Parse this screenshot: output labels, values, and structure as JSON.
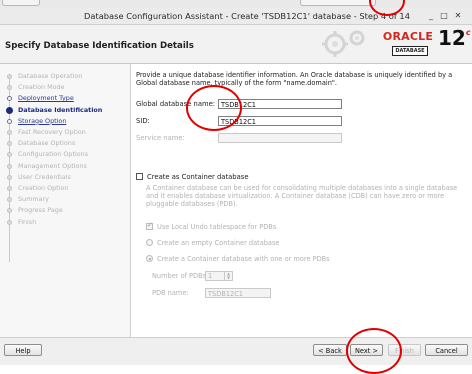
{
  "window": {
    "title": "Database Configuration Assistant - Create 'TSDB12C1' database - Step 4 of 14",
    "minimize_glyph": "_",
    "maximize_glyph": "□",
    "close_glyph": "✕"
  },
  "header": {
    "page_title": "Specify Database Identification Details",
    "logo_word": "ORACLE",
    "logo_sub": "DATABASE",
    "version_number": "12",
    "version_letter": "c"
  },
  "nav": {
    "items": [
      {
        "label": "Database Operation",
        "state": "done"
      },
      {
        "label": "Creation Mode",
        "state": "done"
      },
      {
        "label": "Deployment Type",
        "state": "link"
      },
      {
        "label": "Database Identification",
        "state": "current"
      },
      {
        "label": "Storage Option",
        "state": "link"
      },
      {
        "label": "Fast Recovery Option",
        "state": "pending"
      },
      {
        "label": "Database Options",
        "state": "pending"
      },
      {
        "label": "Configuration Options",
        "state": "pending"
      },
      {
        "label": "Management Options",
        "state": "pending"
      },
      {
        "label": "User Credentials",
        "state": "pending"
      },
      {
        "label": "Creation Option",
        "state": "pending"
      },
      {
        "label": "Summary",
        "state": "pending"
      },
      {
        "label": "Progress Page",
        "state": "pending"
      },
      {
        "label": "Finish",
        "state": "pending"
      }
    ]
  },
  "content": {
    "intro": "Provide a unique database identifier information. An Oracle database is uniquely identified by a Global database name, typically of the form \"name.domain\".",
    "global_db_name_label": "Global database name:",
    "global_db_name_value": "TSDB12C1",
    "sid_label": "SID:",
    "sid_value": "TSDB12C1",
    "service_name_label": "Service name:",
    "service_name_value": "",
    "container_checkbox_label": "Create as Container database",
    "container_description": "A Container database can be used for consolidating multiple databases into a single database and it enables database virtualization. A Container database (CDB) can have zero or more pluggable databases (PDB).",
    "use_local_undo_label": "Use Local Undo tablespace for PDBs",
    "empty_container_label": "Create an empty Container database",
    "with_pdbs_label": "Create a Container database with one or more PDBs",
    "num_pdbs_label": "Number of PDBs:",
    "num_pdbs_value": "1",
    "pdb_name_label": "PDB name:",
    "pdb_name_value": "TSDB12C1"
  },
  "buttons": {
    "help": "Help",
    "back": "< Back",
    "next": "Next >",
    "finish": "Finish",
    "cancel": "Cancel"
  },
  "colors": {
    "annotation": "#e00000",
    "oracle_red": "#d5261e",
    "nav_link": "#2a3a96"
  }
}
